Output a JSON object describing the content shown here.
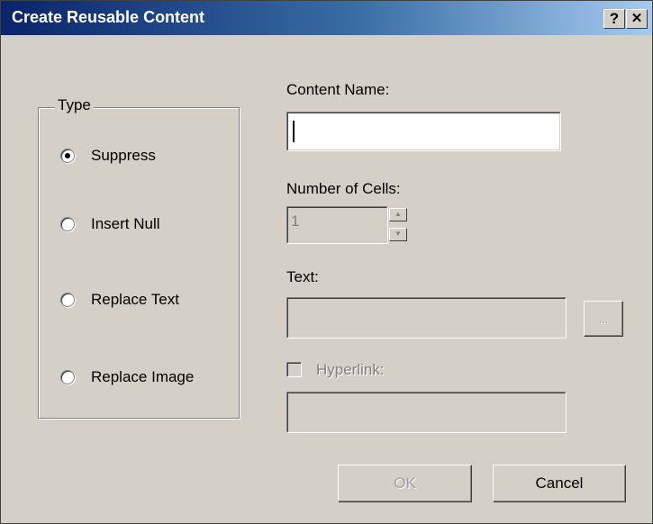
{
  "window": {
    "title": "Create Reusable Content",
    "help_glyph": "?",
    "close_glyph": "✕"
  },
  "type_group": {
    "legend": "Type",
    "options": [
      {
        "label": "Suppress",
        "selected": true
      },
      {
        "label": "Insert Null",
        "selected": false
      },
      {
        "label": "Replace Text",
        "selected": false
      },
      {
        "label": "Replace Image",
        "selected": false
      }
    ]
  },
  "content_name": {
    "label": "Content Name:",
    "value": ""
  },
  "number_of_cells": {
    "label": "Number of Cells:",
    "value": "1",
    "up_glyph": "▲",
    "down_glyph": "▼"
  },
  "text_field": {
    "label": "Text:",
    "value": "",
    "browse_label": "..."
  },
  "hyperlink": {
    "label": "Hyperlink:",
    "checked": false,
    "value": ""
  },
  "buttons": {
    "ok_label": "OK",
    "cancel_label": "Cancel"
  },
  "colors": {
    "title_bar_start": "#0a246a",
    "title_bar_end": "#a6caf0",
    "dialog_face": "#d4d0c8"
  }
}
